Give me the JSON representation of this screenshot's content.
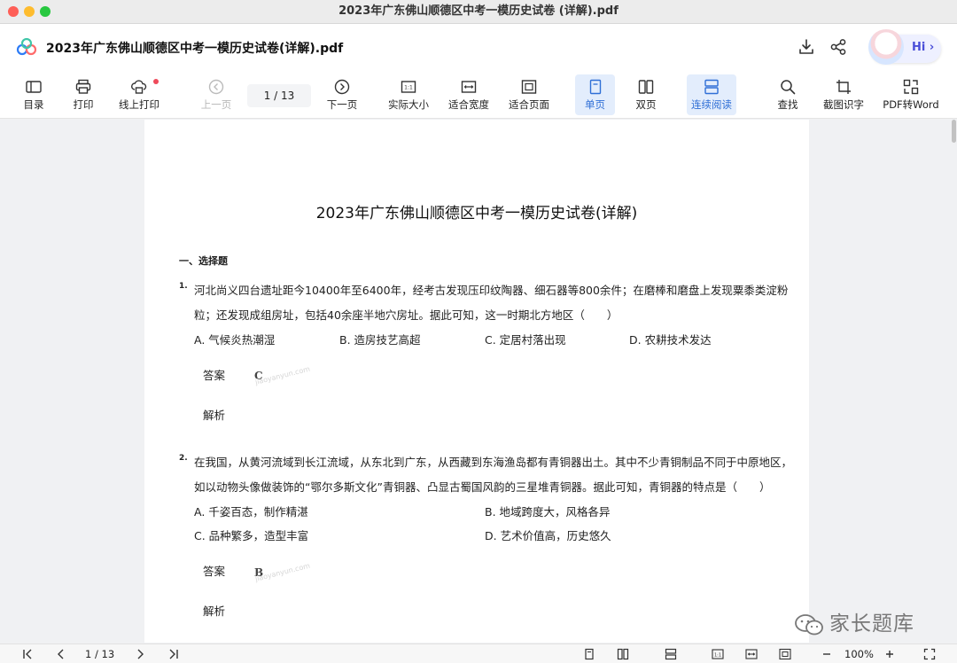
{
  "window": {
    "title": "2023年广东佛山顺德区中考一模历史试卷 (详解).pdf"
  },
  "header": {
    "doc_title": "2023年广东佛山顺德区中考一模历史试卷(详解).pdf",
    "hi_label": "Hi"
  },
  "toolbar": {
    "catalog": "目录",
    "print": "打印",
    "online_print": "线上打印",
    "prev_page": "上一页",
    "page_indicator": "1  /  13",
    "next_page": "下一页",
    "actual_size": "实际大小",
    "fit_width": "适合宽度",
    "fit_page": "适合页面",
    "single_page": "单页",
    "double_page": "双页",
    "continuous": "连续阅读",
    "find": "查找",
    "screenshot_ocr": "截图识字",
    "pdf_to_word": "PDF转Word"
  },
  "document": {
    "title": "2023年广东佛山顺德区中考一模历史试卷(详解)",
    "section": "一、选择题",
    "watermark": "jiaoyanyun.com",
    "answer_label": "答案",
    "analysis_label": "解析",
    "questions": [
      {
        "num": "1.",
        "lines": [
          "河北尚义四台遗址距今10400年至6400年，经考古发现压印纹陶器、细石器等800余件；在磨棒和磨盘上发现粟黍类淀粉",
          "粒；还发现成组房址，包括40余座半地穴房址。据此可知，这一时期北方地区（　　）"
        ],
        "options": [
          "A. 气候炎热潮湿",
          "B. 造房技艺高超",
          "C. 定居村落出现",
          "D. 农耕技术发达"
        ],
        "answer": "C"
      },
      {
        "num": "2.",
        "lines": [
          "在我国，从黄河流域到长江流域，从东北到广东，从西藏到东海渔岛都有青铜器出土。其中不少青铜制品不同于中原地区，",
          "如以动物头像做装饰的“鄂尔多斯文化”青铜器、凸显古蜀国风韵的三星堆青铜器。据此可知，青铜器的特点是（　　）"
        ],
        "options": [
          "A. 千姿百态，制作精湛",
          "B. 地域跨度大，风格各异",
          "C. 品种繁多，造型丰富",
          "D. 艺术价值高，历史悠久"
        ],
        "answer": "B"
      }
    ]
  },
  "brand_watermark": "家长题库",
  "bottom": {
    "page_indicator": "1  /  13",
    "zoom": "100%"
  },
  "colors": {
    "accent": "#2f6fd6",
    "active_bg": "#e3edfc",
    "notif": "#ef4a5b"
  }
}
